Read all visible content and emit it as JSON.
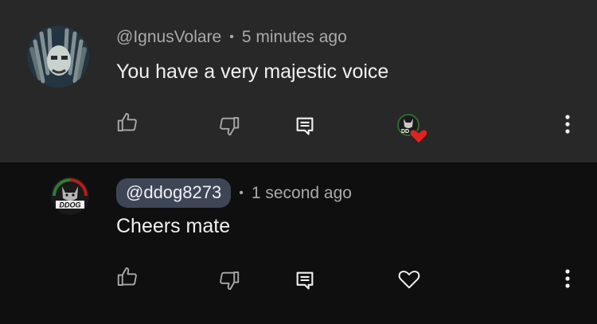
{
  "comments": [
    {
      "author": "@IgnusVolare",
      "separator": "•",
      "time": "5 minutes ago",
      "text": "You have a very majestic voice",
      "hearted_by_creator": true,
      "avatar_icon": "dreadlocks-avatar",
      "actions": [
        "like-icon",
        "dislike-icon",
        "reply-icon",
        "creator-heart-badge",
        "more-vert-icon"
      ]
    },
    {
      "author": "@ddog8273",
      "separator": "•",
      "time": "1 second ago",
      "text": "Cheers mate",
      "avatar_text": "DDOG",
      "actions": [
        "like-icon",
        "dislike-icon",
        "reply-icon",
        "heart-icon",
        "more-vert-icon"
      ]
    }
  ],
  "badge_text": "DD",
  "colors": {
    "top_bg": "#282828",
    "reply_bg": "#0f0f0f",
    "meta_text": "#aaaaaa",
    "body_text": "#f1f1f1",
    "handle_pill": "#3e4656",
    "heart_red": "#e0231f"
  }
}
